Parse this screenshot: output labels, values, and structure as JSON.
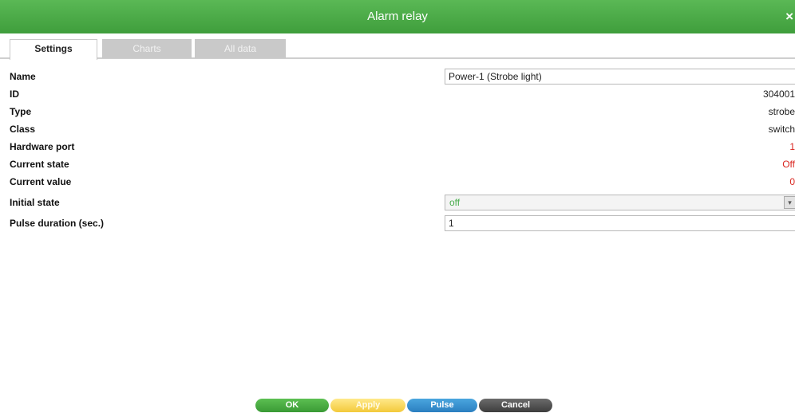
{
  "window": {
    "title": "Alarm relay",
    "close_label": "×"
  },
  "tabs": [
    {
      "label": "Settings",
      "active": true
    },
    {
      "label": "Charts",
      "active": false
    },
    {
      "label": "All data",
      "active": false
    }
  ],
  "fields": {
    "name": {
      "label": "Name",
      "value": "Power-1 (Strobe light)"
    },
    "id": {
      "label": "ID",
      "value": "304001"
    },
    "type": {
      "label": "Type",
      "value": "strobe"
    },
    "class": {
      "label": "Class",
      "value": "switch"
    },
    "hardware_port": {
      "label": "Hardware port",
      "value": "1"
    },
    "current_state": {
      "label": "Current state",
      "value": "Off"
    },
    "current_value": {
      "label": "Current value",
      "value": "0"
    },
    "initial_state": {
      "label": "Initial state",
      "value": "off",
      "arrow_glyph": "▾"
    },
    "pulse_duration": {
      "label": "Pulse duration (sec.)",
      "value": "1"
    }
  },
  "buttons": {
    "ok": "OK",
    "apply": "Apply",
    "pulse": "Pulse",
    "cancel": "Cancel"
  },
  "colors": {
    "title_green": "#4caf50",
    "state_red": "#d9251f",
    "ok_green": "#3a9a35",
    "apply_yellow": "#f3c93b",
    "pulse_blue": "#2b7fc0",
    "cancel_gray": "#3d3d3d"
  }
}
